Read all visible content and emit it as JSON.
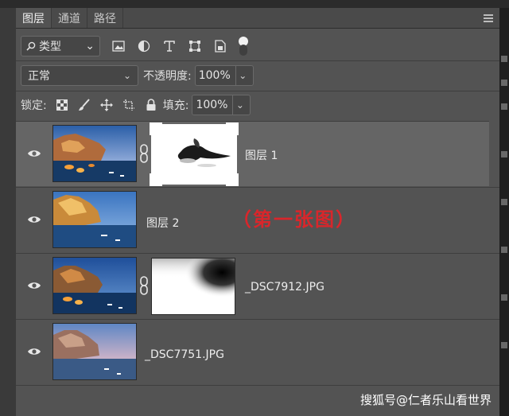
{
  "tabs": [
    {
      "label": "图层",
      "active": true
    },
    {
      "label": "通道",
      "active": false
    },
    {
      "label": "路径",
      "active": false
    }
  ],
  "filter": {
    "icon": "search-icon",
    "label": "类型",
    "chevron": "⌄"
  },
  "blend_mode": {
    "value": "正常",
    "chevron": "⌄"
  },
  "opacity": {
    "label": "不透明度:",
    "value": "100%",
    "chevron": "⌄"
  },
  "lock": {
    "label": "锁定:"
  },
  "fill": {
    "label": "填充:",
    "value": "100%",
    "chevron": "⌄"
  },
  "layers": [
    {
      "name": "图层 1",
      "visible": true,
      "selected": true,
      "has_mask": true
    },
    {
      "name": "图层 2",
      "visible": true,
      "selected": false,
      "has_mask": false,
      "annotation": "（第一张图）"
    },
    {
      "name": "_DSC7912.JPG",
      "visible": true,
      "selected": false,
      "has_mask": true
    },
    {
      "name": "_DSC7751.JPG",
      "visible": true,
      "selected": false,
      "has_mask": false
    }
  ],
  "watermark": "搜狐号@仁者乐山看世界",
  "colors": {
    "panel": "#535353",
    "selected_row": "#656565",
    "annotation_red": "#d9262b"
  }
}
